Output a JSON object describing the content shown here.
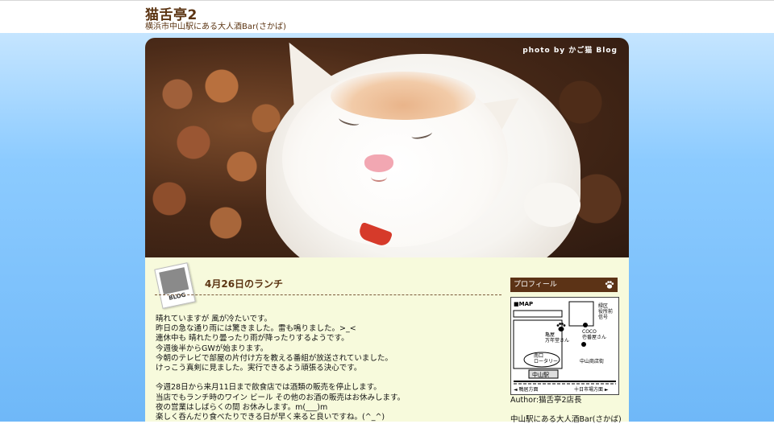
{
  "header": {
    "site_title": "猫舌亭2",
    "site_description": "横浜市中山駅にある大人酒Bar(さかば)"
  },
  "hero": {
    "credit": "photo by かご猫 Blog"
  },
  "post": {
    "badge_label": "BLOG",
    "title": "4月26日のランチ",
    "lines": [
      "晴れていますが 風が冷たいです。",
      "昨日の急な通り雨には驚きました。雷も鳴りました。>_<",
      "連休中も 晴れたり曇ったり雨が降ったりするようです。",
      "今週後半からGWが始まります。",
      "今朝のテレビで部屋の片付け方を教える番組が放送されていました。",
      "けっこう真剣に見ました。実行できるよう頑張る決心です。",
      "",
      "今週28日から来月11日まで飲食店では酒類の販売を停止します。",
      "当店でもランチ時のワイン ビール その他のお酒の販売はお休みします。",
      "夜の営業はしばらくの間 お休みします。m(___)m",
      "楽しく呑んだり食べたりできる日が早く来ると良いですね。(^_^)"
    ]
  },
  "sidebar": {
    "profile_heading": "プロフィール",
    "map": {
      "title": "■MAP",
      "labels": {
        "ward_office": "緑区\n役所前\n信号",
        "store_name": "亀屋\n万年堂さん",
        "coco": "COCO\n壱番屋さん",
        "south_exit": "南口\nロータリー",
        "shopping_street": "中山商店街",
        "station": "中山駅",
        "kamoi": "◄ 鴨居方面",
        "tokaichiba": "十日市場方面 ►"
      }
    },
    "author": "Author:猫舌亭2店長",
    "description": "中山駅にある大人酒Bar(さかば)"
  },
  "colors": {
    "brand_brown": "#5c3316",
    "content_bg": "#f7fadc",
    "page_bg_blue": "#8ccbff"
  }
}
